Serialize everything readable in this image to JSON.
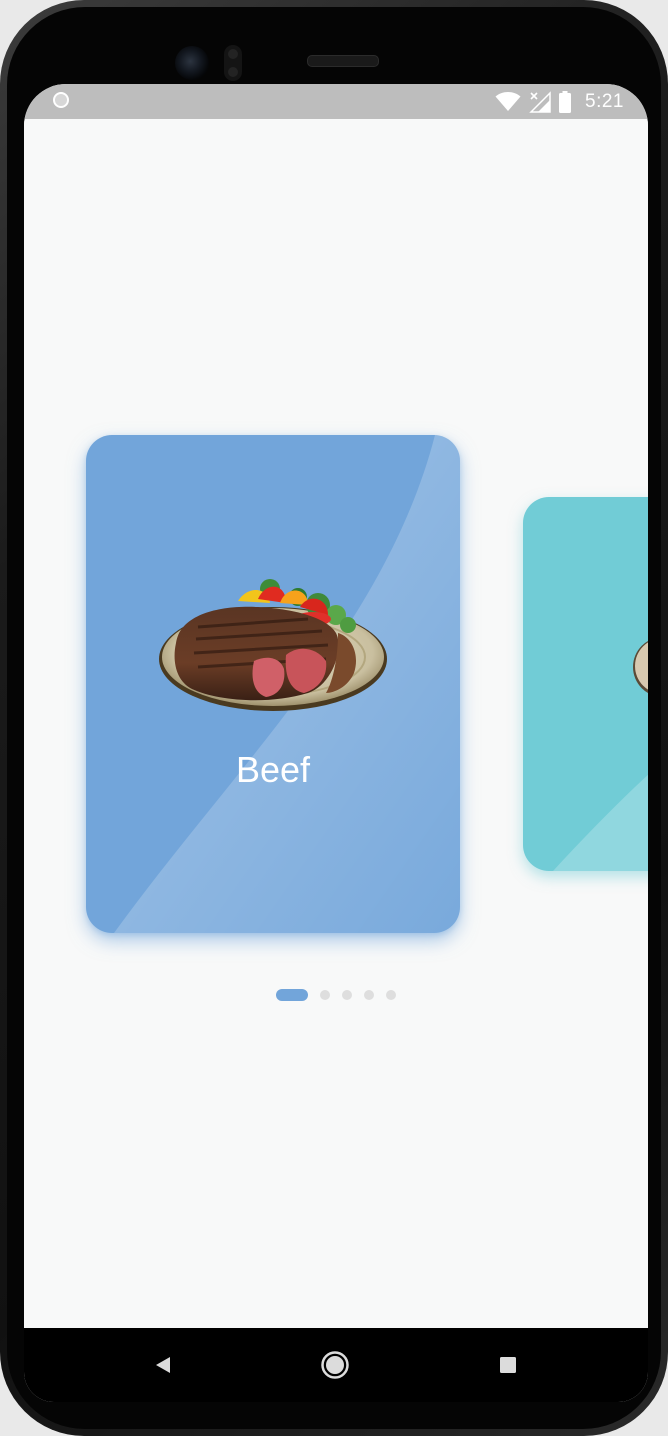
{
  "status_bar": {
    "time": "5:21",
    "icons": [
      "notification-circle-icon",
      "wifi-icon",
      "no-signal-icon",
      "battery-icon"
    ]
  },
  "carousel": {
    "cards": [
      {
        "label": "Beef",
        "image": "steak-plate-image",
        "color": "#72a5da"
      },
      {
        "label": "",
        "image": "food-plate-image",
        "color": "#71ccd6"
      }
    ],
    "page_count": 5,
    "active_index": 0,
    "indicator_active_color": "#72a5da",
    "indicator_inactive_color": "#dedede"
  },
  "nav_bar": {
    "buttons": [
      "back-icon",
      "home-icon",
      "recents-icon"
    ]
  }
}
